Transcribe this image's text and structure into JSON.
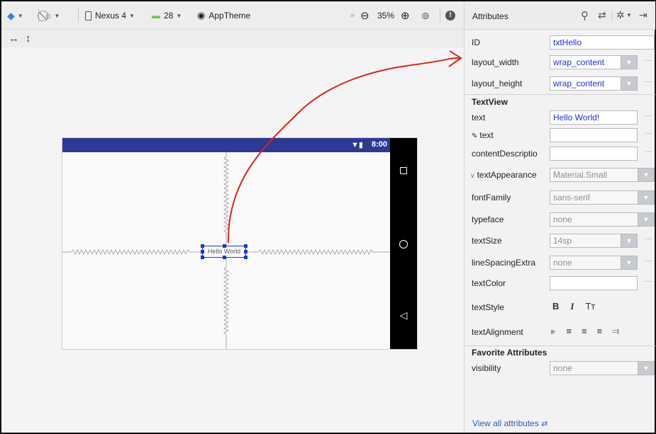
{
  "toolbar": {
    "device": "Nexus 4",
    "api": "28",
    "theme": "AppTheme",
    "zoom": "35%"
  },
  "device_preview": {
    "time": "8:00",
    "text": "Hello World"
  },
  "attributes": {
    "title": "Attributes",
    "id_label": "ID",
    "id_value": "txtHello",
    "layout_width_label": "layout_width",
    "layout_width_value": "wrap_content",
    "layout_height_label": "layout_height",
    "layout_height_value": "wrap_content",
    "section_textview": "TextView",
    "text_label": "text",
    "text_value": "Hello World!",
    "design_text_label": "text",
    "content_description_label": "contentDescriptio",
    "text_appearance_label": "textAppearance",
    "text_appearance_value": "Material.Small",
    "font_family_label": "fontFamily",
    "font_family_value": "sans-serif",
    "typeface_label": "typeface",
    "typeface_value": "none",
    "text_size_label": "textSize",
    "text_size_value": "14sp",
    "line_spacing_label": "lineSpacingExtra",
    "line_spacing_value": "none",
    "text_color_label": "textColor",
    "text_style_label": "textStyle",
    "text_alignment_label": "textAlignment",
    "section_favorites": "Favorite Attributes",
    "visibility_label": "visibility",
    "visibility_value": "none",
    "view_all": "View all attributes"
  },
  "colors": {
    "status_bar": "#2c3a96",
    "selection": "#1a33d9",
    "annotation_arrow": "#e0221e"
  }
}
